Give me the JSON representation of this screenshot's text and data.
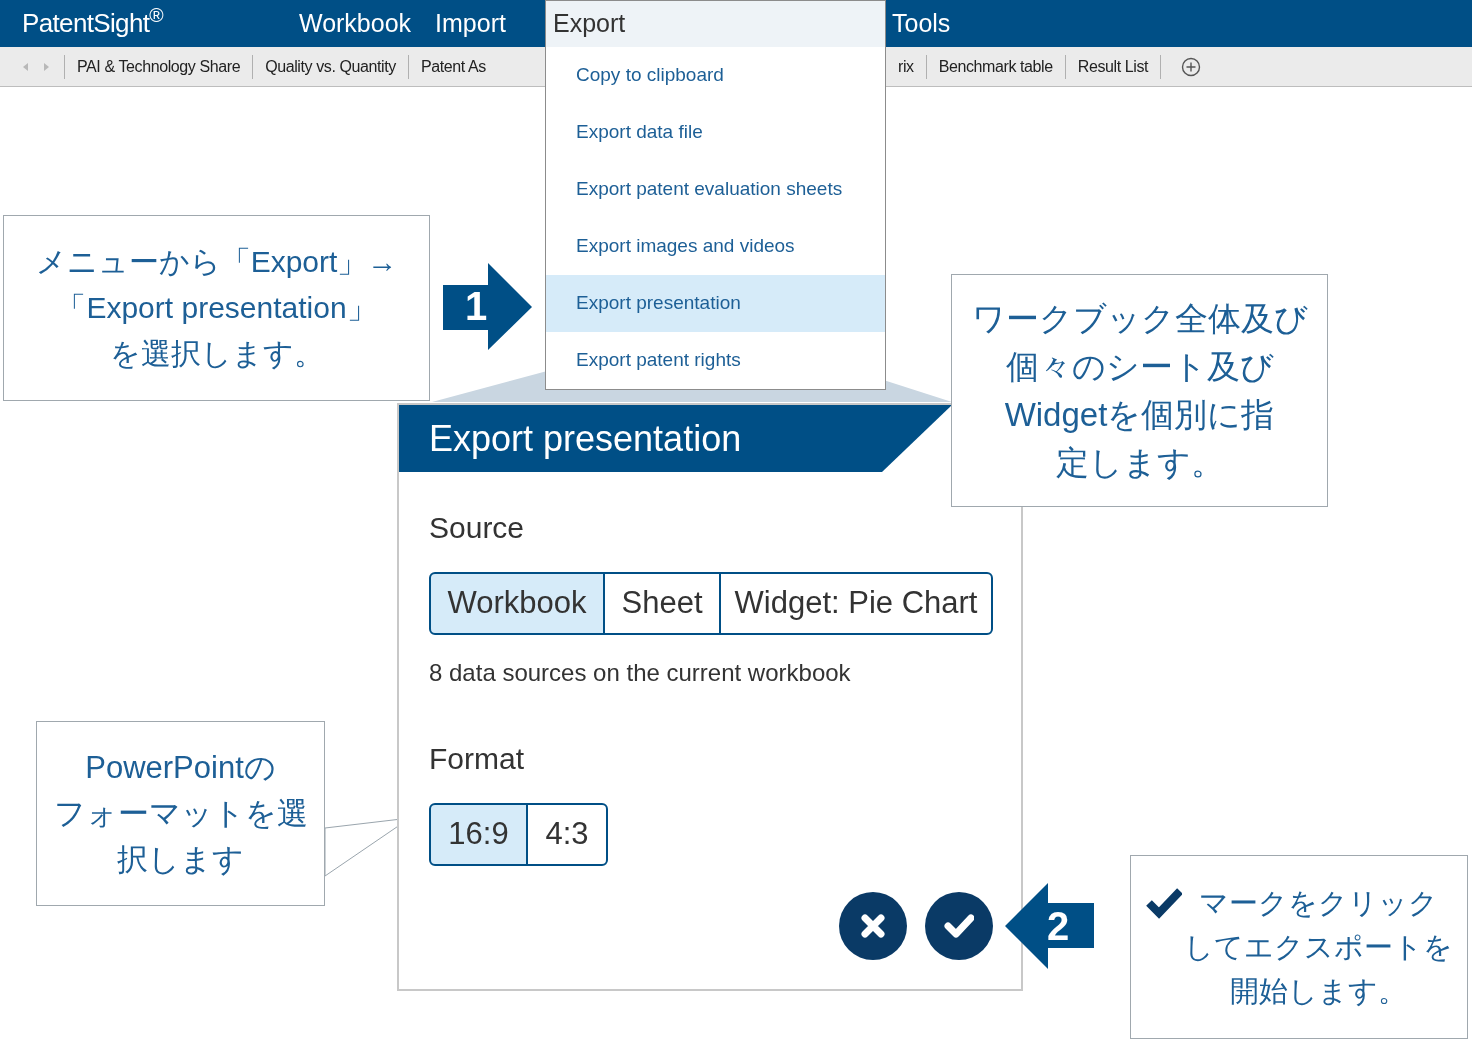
{
  "app": {
    "logo": "PatentSight$^{®}$"
  },
  "menu_bar": {
    "left_of_menu": [
      {
        "label": "Workbook"
      },
      {
        "label": "Import"
      }
    ],
    "right_of_menu": [
      {
        "label": "Tools"
      }
    ]
  },
  "sheet_tabs": {
    "left_of_menu": [
      {
        "label": "PAI & Technology Share",
        "selected": false
      },
      {
        "label": "Quality vs. Quantity",
        "selected": false
      },
      {
        "label": "Patent As",
        "selected": false
      }
    ],
    "right_of_menu": [
      {
        "label": "rix",
        "selected": false
      },
      {
        "label": "Benchmark table",
        "selected": false
      },
      {
        "label": "Result List",
        "selected": false
      }
    ]
  },
  "export_menu": {
    "title": "Export",
    "items": [
      {
        "label": "Copy to clipboard",
        "selected": false
      },
      {
        "label": "Export data file",
        "selected": false
      },
      {
        "label": "Export patent evaluation sheets",
        "selected": false
      },
      {
        "label": "Export images and videos",
        "selected": false
      },
      {
        "label": "Export presentation",
        "selected": true
      },
      {
        "label": "Export patent rights",
        "selected": false
      }
    ]
  },
  "dialog": {
    "title": "Export presentation",
    "source_label": "Source",
    "source_options": [
      {
        "label": "Workbook",
        "selected": true
      },
      {
        "label": "Sheet",
        "selected": false
      },
      {
        "label": "Widget: Pie Chart",
        "selected": false
      }
    ],
    "source_note": "8 data sources on the current workbook",
    "format_label": "Format",
    "format_options": [
      {
        "label": "16:9",
        "selected": true
      },
      {
        "label": "4:3",
        "selected": false
      }
    ],
    "buttons": [
      {
        "kind": "cancel"
      },
      {
        "kind": "confirm"
      }
    ]
  },
  "annotations": [
    {
      "kind": "callout",
      "lines": [
        "メニューから「Export」→",
        "「Export presentation」",
        "を選択します。"
      ]
    },
    {
      "kind": "step",
      "number": "1"
    },
    {
      "kind": "callout",
      "lines": [
        "ワークブック全体及び",
        "個々のシート及び",
        "Widgetを個別に指",
        "定します。"
      ]
    },
    {
      "kind": "callout",
      "lines": [
        "PowerPointの",
        "フォーマットを選",
        "択します"
      ]
    },
    {
      "kind": "step",
      "number": "2"
    },
    {
      "kind": "check_callout",
      "lines": [
        "マークをクリック",
        "してエクスポートを",
        "開始します。"
      ]
    }
  ]
}
